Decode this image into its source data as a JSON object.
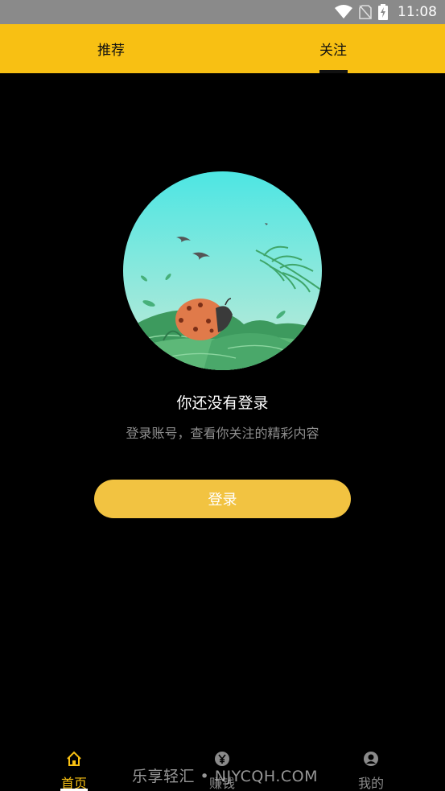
{
  "status_bar": {
    "time": "11:08",
    "icons": [
      "wifi-icon",
      "no-sim-icon",
      "battery-charging-icon"
    ]
  },
  "tabs": [
    {
      "label": "推荐",
      "active": false
    },
    {
      "label": "关注",
      "active": true
    }
  ],
  "empty_state": {
    "title": "你还没有登录",
    "subtitle": "登录账号，查看你关注的精彩内容",
    "button_label": "登录"
  },
  "bottom_nav": [
    {
      "label": "首页",
      "icon": "home-icon",
      "active": true
    },
    {
      "label": "赚钱",
      "icon": "yen-coin-icon",
      "active": false
    },
    {
      "label": "我的",
      "icon": "user-icon",
      "active": false
    }
  ],
  "watermark": "乐享轻汇 • NJYCQH.COM",
  "colors": {
    "accent": "#f8c013",
    "button": "#f2c341",
    "background": "#000000"
  }
}
